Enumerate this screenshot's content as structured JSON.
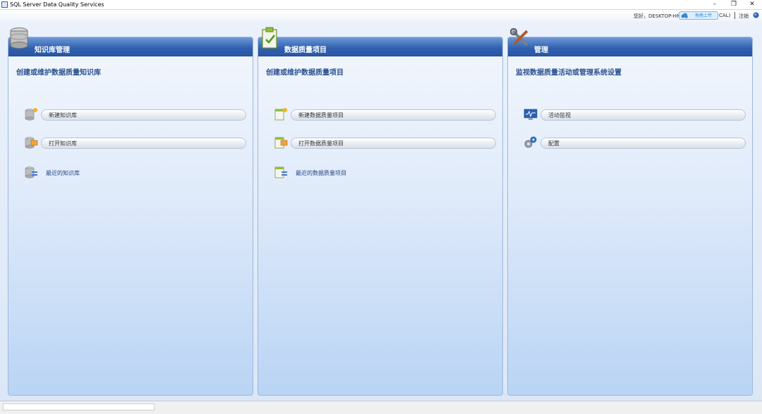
{
  "window": {
    "title": "SQL Server Data Quality Services",
    "controls": {
      "minimize": "–",
      "maximize": "❐",
      "close": "✕"
    }
  },
  "topbar": {
    "greeting": "您好，DESKTOP-HN",
    "greeting_suffix": "CAL)",
    "upload_badge": "拖拽上传",
    "logout": "注销",
    "help_icon": "help-circle-icon"
  },
  "panels": [
    {
      "title": "知识库管理",
      "header_icon": "database-icon",
      "subtitle": "创建或维护数据质量知识库",
      "actions": [
        {
          "label": "新建知识库",
          "icon": "new-database-icon"
        },
        {
          "label": "打开知识库",
          "icon": "open-database-icon"
        }
      ],
      "link": {
        "label": "最近的知识库",
        "icon": "recent-database-icon"
      }
    },
    {
      "title": "数据质量项目",
      "header_icon": "clipboard-check-icon",
      "subtitle": "创建或维护数据质量项目",
      "actions": [
        {
          "label": "新建数据质量项目",
          "icon": "new-project-icon"
        },
        {
          "label": "打开数据质量项目",
          "icon": "open-project-icon"
        }
      ],
      "link": {
        "label": "最近的数据质量项目",
        "icon": "recent-project-icon"
      }
    },
    {
      "title": "管理",
      "header_icon": "tools-icon",
      "subtitle": "监视数据质量活动或管理系统设置",
      "actions": [
        {
          "label": "活动监视",
          "icon": "activity-monitor-icon"
        },
        {
          "label": "配置",
          "icon": "gears-icon"
        }
      ]
    }
  ],
  "colors": {
    "header_blue": "#2f5fae",
    "subtitle_blue": "#2a4f91",
    "panel_bg": "#dfeafa"
  }
}
